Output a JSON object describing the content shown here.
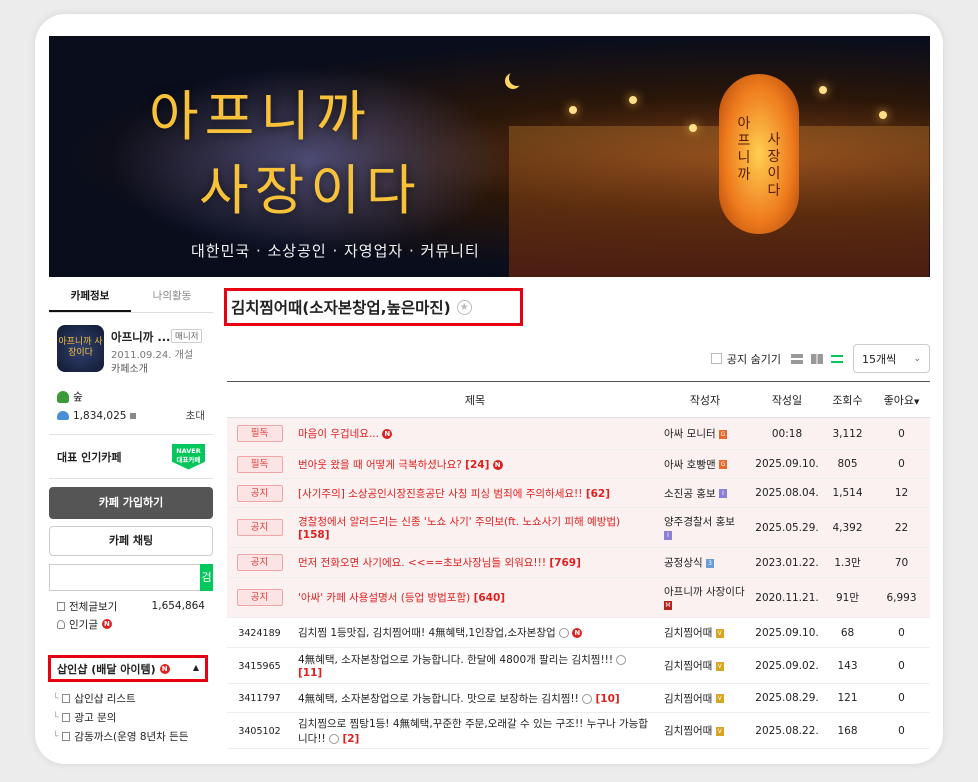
{
  "banner": {
    "title_line1": "아프니까",
    "title_line2": "사장이다",
    "subtitle": "대한민국 · 소상공인 · 자영업자 · 커뮤니티",
    "lantern_left": "아프니까",
    "lantern_right": "사장이다"
  },
  "sidebar": {
    "tab_info": "카페정보",
    "tab_activity": "나의활동",
    "logo_text": "아프니까 사장이다",
    "cafe_name": "아프니까 ...",
    "manager_label": "매니저",
    "open_date": "2011.09.24. 개설",
    "intro_link": "카페소개",
    "level_name": "숲",
    "member_count": "1,834,025",
    "invite_label": "초대",
    "rep_label": "대표 인기카페",
    "naver_badge_line1": "NAVER",
    "naver_badge_line2": "대표카페",
    "join_button": "카페 가입하기",
    "chat_button": "카페 채팅",
    "search_button": "검색",
    "all_posts_label": "전체글보기",
    "all_posts_count": "1,654,864",
    "popular_label": "인기글",
    "new_badge": "N",
    "highlighted_menu": "삽인샵 (배달 아이템)",
    "sub_items": [
      "삽인샵 리스트",
      "광고 문의",
      "감동까스(운영 8년차 든든"
    ]
  },
  "main": {
    "board_title": "김치찜어때(소자본창업,높은마진)",
    "star_icon": "★",
    "hide_notice_label": "공지 숨기기",
    "per_page": "15개씩",
    "columns": {
      "title": "제목",
      "author": "작성자",
      "date": "작성일",
      "views": "조회수",
      "likes": "좋아요"
    },
    "rows": [
      {
        "tag": "필독",
        "title": "마음이 우겁네요...",
        "comments": "",
        "new": true,
        "author": "아싸 모니터",
        "lvl": "G",
        "lvl_color": "#e8692c",
        "date": "00:18",
        "views": "3,112",
        "likes": "0"
      },
      {
        "tag": "필독",
        "title": "번아웃 왔을 때 어떻게 극복하셨나요?",
        "comments": "[24]",
        "new": true,
        "author": "아싸 호빵맨",
        "lvl": "G",
        "lvl_color": "#e8692c",
        "date": "2025.09.10.",
        "views": "805",
        "likes": "0"
      },
      {
        "tag": "공지",
        "title": "[사기주의] 소상공인시장진흥공단 사칭 피싱 범죄에 주의하세요!!",
        "comments": "[62]",
        "new": false,
        "author": "소진공 홍보",
        "lvl": "I",
        "lvl_color": "#8b7fd6",
        "date": "2025.08.04.",
        "views": "1,514",
        "likes": "12"
      },
      {
        "tag": "공지",
        "title": "경찰청에서 알려드리는 신종 '노쇼 사기' 주의보(ft. 노쇼사기 피해 예방법)",
        "comments": "[158]",
        "new": false,
        "author": "양주경찰서 홍보",
        "lvl": "I",
        "lvl_color": "#8b7fd6",
        "date": "2025.05.29.",
        "views": "4,392",
        "likes": "22"
      },
      {
        "tag": "공지",
        "title": "먼저 전화오면 사기에요. <<==초보사장님들 외워요!!!",
        "comments": "[769]",
        "new": false,
        "author": "공정상식",
        "lvl": "3",
        "lvl_color": "#6a9cd8",
        "date": "2023.01.22.",
        "views": "1.3만",
        "likes": "70"
      },
      {
        "tag": "공지",
        "title": "'아싸' 카페 사용설명서 (등업 방법포함)",
        "comments": "[640]",
        "new": false,
        "author": "아프니까 사장이다",
        "lvl": "M",
        "lvl_color": "#b3261e",
        "date": "2020.11.21.",
        "views": "91만",
        "likes": "6,993"
      },
      {
        "num": "3424189",
        "title": "김치찜 1등맛집, 김치찜어때! 4無혜택,1인창업,소자본창업",
        "comments": "",
        "emo": true,
        "new": true,
        "author": "김치찜어때",
        "lvl": "V",
        "lvl_color": "#d9a520",
        "date": "2025.09.10.",
        "views": "68",
        "likes": "0"
      },
      {
        "num": "3415965",
        "title": "4無혜택, 소자본창업으로 가능합니다. 한달에 4800개 팔리는 김치찜!!!",
        "comments": "[11]",
        "emo": true,
        "new": false,
        "author": "김치찜어때",
        "lvl": "V",
        "lvl_color": "#d9a520",
        "date": "2025.09.02.",
        "views": "143",
        "likes": "0"
      },
      {
        "num": "3411797",
        "title": "4無혜택, 소자본창업으로 가능합니다. 맛으로 보장하는 김치찜!!",
        "comments": "[10]",
        "emo": true,
        "new": false,
        "author": "김치찜어때",
        "lvl": "V",
        "lvl_color": "#d9a520",
        "date": "2025.08.29.",
        "views": "121",
        "likes": "0"
      },
      {
        "num": "3405102",
        "title": "김치찜으로 찜탕1등! 4無혜택,꾸준한 주문,오래갈 수 있는 구조!! 누구나 가능합니다!!",
        "comments": "[2]",
        "emo": true,
        "new": false,
        "author": "김치찜어때",
        "lvl": "V",
        "lvl_color": "#d9a520",
        "date": "2025.08.22.",
        "views": "168",
        "likes": "0"
      }
    ]
  }
}
